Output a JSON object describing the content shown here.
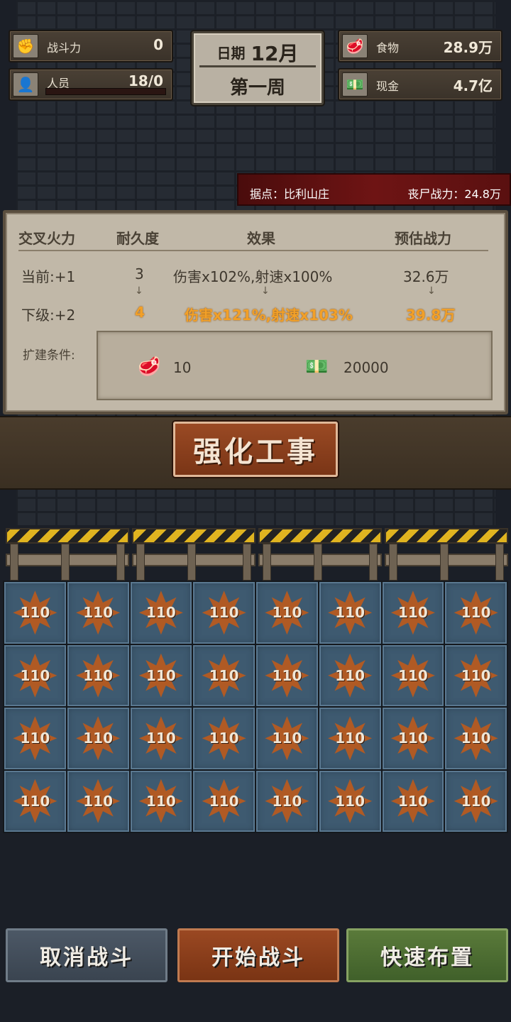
{
  "stats": {
    "combat": {
      "label": "战斗力",
      "value": "0",
      "icon": "fist-icon"
    },
    "personnel": {
      "label": "人员",
      "value": "18/0",
      "icon": "person-icon"
    },
    "food": {
      "label": "食物",
      "value": "28.9万",
      "icon": "meat-icon"
    },
    "cash": {
      "label": "现金",
      "value": "4.7亿",
      "icon": "cash-icon"
    }
  },
  "date": {
    "label": "日期",
    "month": "12月",
    "week": "第一周"
  },
  "banner": {
    "location": "据点：比利山庄",
    "zombie_power": "丧尸战力：24.8万"
  },
  "upgrade": {
    "headers": [
      "交叉火力",
      "耐久度",
      "效果",
      "预估战力"
    ],
    "current": {
      "level": "当前:+1",
      "durability": "3",
      "effect": "伤害x102%,射速x100%",
      "power": "32.6万"
    },
    "next": {
      "level": "下级:+2",
      "durability": "4",
      "effect": "伤害x121%,射速x103%",
      "power": "39.8万"
    },
    "arrow": "↓",
    "condition_label": "扩建条件:",
    "costs": [
      {
        "icon": "meat-icon",
        "amount": "10"
      },
      {
        "icon": "cash-icon",
        "amount": "20000"
      }
    ],
    "button": "强化工事"
  },
  "grid": {
    "rows": 4,
    "cols": 8,
    "tile_value": "110"
  },
  "buttons": {
    "cancel": "取消战斗",
    "start": "开始战斗",
    "quick": "快速布置"
  },
  "colors": {
    "next_highlight": "#f2a028",
    "banner": "#6e1414",
    "tile": "#3e5a70",
    "star": "#b05a24"
  }
}
